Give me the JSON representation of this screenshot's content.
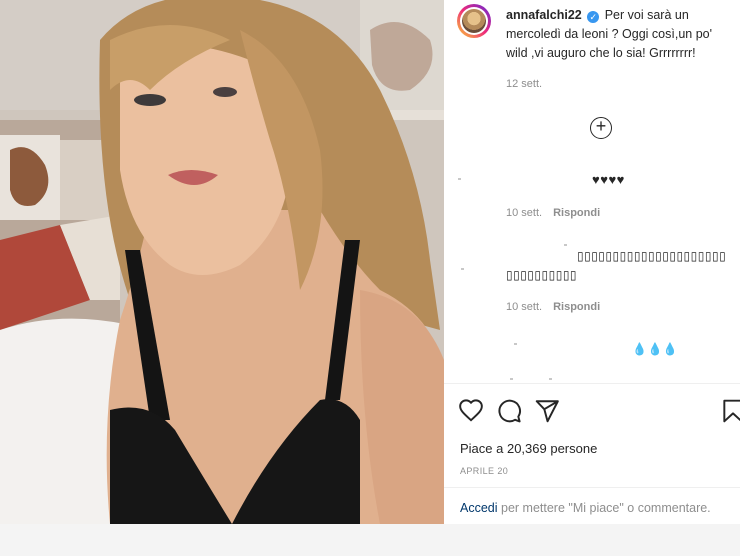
{
  "post": {
    "username": "annafalchi22",
    "verified_mark": "✓",
    "caption": "Per voi sarà un mercoledì da leoni ? Oggi così,un po' wild ,vi auguro che lo sia! Grrrrrrrr!",
    "caption_age": "12 sett.",
    "load_more_icon": "plus-circle-icon"
  },
  "comments": [
    {
      "text": "♥♥♥♥",
      "age": "10 sett.",
      "reply": "Rispondi"
    },
    {
      "text_line1": "▯▯▯▯▯▯▯▯▯▯▯▯▯▯▯▯▯▯▯▯▯",
      "text_line2": "▯▯▯▯▯▯▯▯▯▯",
      "age": "10 sett.",
      "reply": "Rispondi"
    },
    {
      "text": "💧💧💧"
    }
  ],
  "actions": {
    "icons": [
      "heart-icon",
      "comment-icon",
      "share-icon",
      "bookmark-icon"
    ],
    "likes": "Piace a 20,369 persone",
    "date": "APRILE 20"
  },
  "login": {
    "link": "Accedi",
    "rest": " per mettere \"Mi piace\" o commentare."
  },
  "colors": {
    "link": "#00376b",
    "secondary_text": "#8e8e8e",
    "verified": "#3897f0"
  }
}
